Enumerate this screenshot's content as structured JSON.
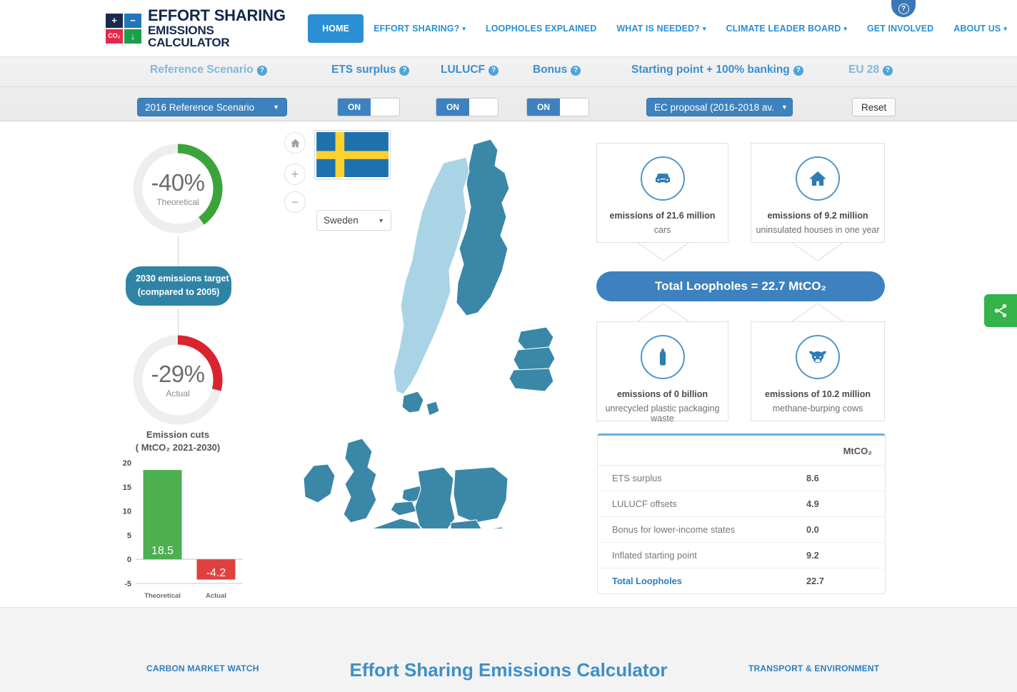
{
  "header": {
    "help_badge": "?",
    "logo": {
      "cells": [
        "+",
        "−",
        "CO₂",
        "↓"
      ],
      "line1": "EFFORT SHARING",
      "line2": "EMISSIONS CALCULATOR"
    },
    "nav": [
      {
        "label": "HOME",
        "active": true,
        "caret": false
      },
      {
        "label": "EFFORT SHARING?",
        "active": false,
        "caret": true
      },
      {
        "label": "LOOPHOLES EXPLAINED",
        "active": false,
        "caret": false
      },
      {
        "label": "WHAT IS NEEDED?",
        "active": false,
        "caret": true
      },
      {
        "label": "CLIMATE LEADER BOARD",
        "active": false,
        "caret": true
      },
      {
        "label": "GET INVOLVED",
        "active": false,
        "caret": false
      },
      {
        "label": "ABOUT US",
        "active": false,
        "caret": true
      }
    ]
  },
  "controls": {
    "reference_scenario": {
      "label": "Reference Scenario",
      "value": "2016 Reference Scenario"
    },
    "ets_surplus": {
      "label": "ETS surplus",
      "state": "ON"
    },
    "lulucf": {
      "label": "LULUCF",
      "state": "ON"
    },
    "bonus": {
      "label": "Bonus",
      "state": "ON"
    },
    "starting_point": {
      "label": "Starting point + 100% banking",
      "value": "EC proposal (2016-2018 av."
    },
    "eu28": {
      "label": "EU 28"
    },
    "reset": "Reset",
    "help_glyph": "?"
  },
  "gauges": {
    "theoretical": {
      "value": "-40%",
      "sublabel": "Theoretical",
      "percent": 40,
      "color": "#3aa43a"
    },
    "actual": {
      "value": "-29%",
      "sublabel": "Actual",
      "percent": 29,
      "color": "#d9232e"
    },
    "pill_line1": "2030 emissions target",
    "pill_line2": "(compared to 2005)"
  },
  "chart_data": {
    "type": "bar",
    "title": "Emission cuts",
    "subtitle": "( MtCO₂ 2021-2030)",
    "categories": [
      "Theoretical",
      "Actual"
    ],
    "values": [
      18.5,
      -4.2
    ],
    "labels": [
      "18.5",
      "-4.2"
    ],
    "colors": [
      "#4caf50",
      "#e04040"
    ],
    "ylabel": "",
    "xlabel": "",
    "ylim": [
      -5,
      20
    ],
    "yticks": [
      20,
      15,
      10,
      5,
      0,
      -5
    ],
    "ytick_labels": [
      "20",
      "15",
      "10",
      "5",
      "0",
      "-5"
    ],
    "grid": false,
    "legend": false
  },
  "map": {
    "home_icon": "home-icon",
    "zoom_in": "+",
    "zoom_out": "−",
    "country": "Sweden",
    "flag": "sweden-flag",
    "selected_color": "#a9d4e6",
    "base_color": "#3a87a8"
  },
  "loopholes": {
    "total": "Total Loopholes = 22.7 MtCO₂",
    "cards": [
      {
        "icon": "car-icon",
        "big": "emissions of 21.6 million",
        "small": "cars"
      },
      {
        "icon": "house-icon",
        "big": "emissions of 9.2 million",
        "small": "uninsulated houses in one year"
      },
      {
        "icon": "bottle-icon",
        "big": "emissions of 0 billion",
        "small": "unrecycled plastic packaging waste"
      },
      {
        "icon": "cow-icon",
        "big": "emissions of 10.2 million",
        "small": "methane-burping cows"
      }
    ]
  },
  "table": {
    "unit_header": "MtCO₂",
    "rows": [
      {
        "label": "ETS surplus",
        "value": "8.6"
      },
      {
        "label": "LULUCF offsets",
        "value": "4.9"
      },
      {
        "label": "Bonus for lower-income states",
        "value": "0.0"
      },
      {
        "label": "Inflated starting point",
        "value": "9.2"
      }
    ],
    "total": {
      "label": "Total Loopholes",
      "value": "22.7"
    }
  },
  "share": {
    "icon": "share-icon",
    "color": "#34b34a"
  },
  "footer": {
    "left": "CARBON MARKET WATCH",
    "center": "Effort Sharing Emissions Calculator",
    "right": "TRANSPORT & ENVIRONMENT"
  }
}
